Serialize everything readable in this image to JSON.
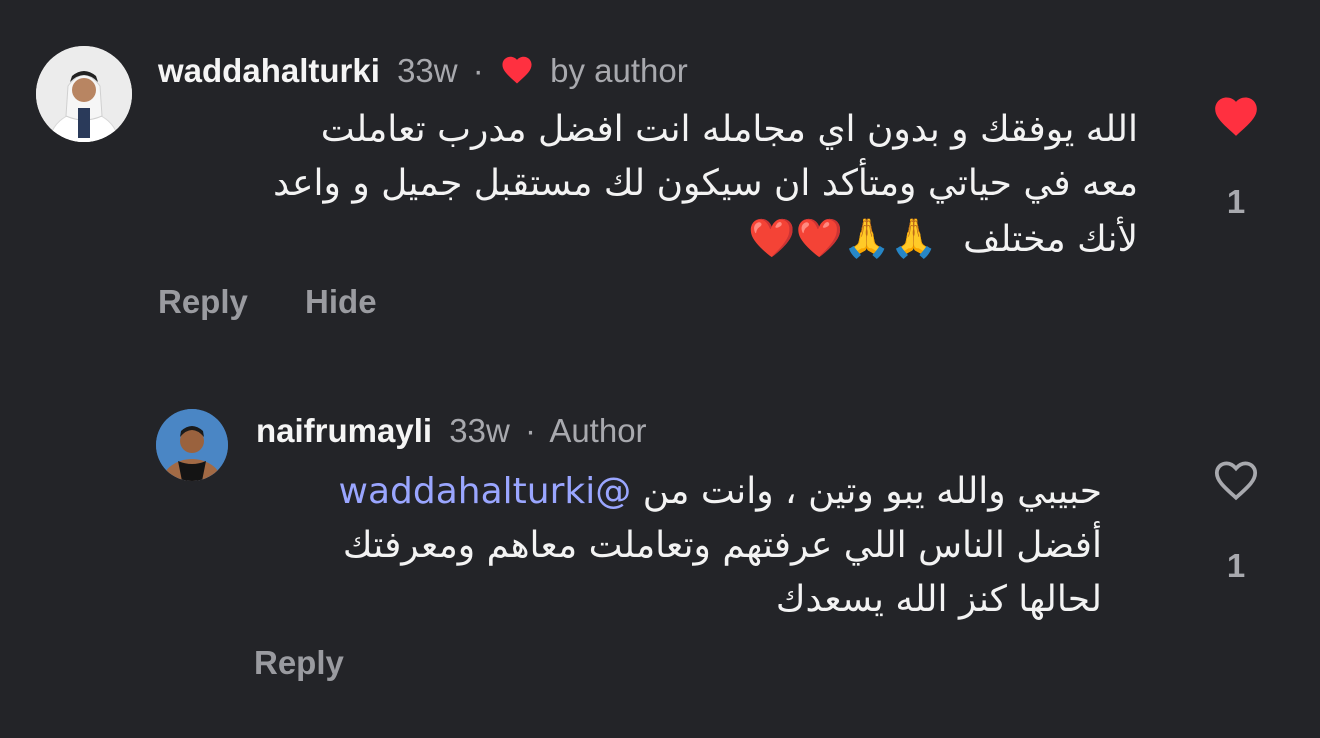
{
  "comments": [
    {
      "username": "waddahalturki",
      "time": "33w",
      "separator": "·",
      "liked_by_author_label": "by author",
      "text_lines": [
        "الله يوفقك و بدون اي مجامله انت افضل مدرب تعاملت",
        "معه في حياتي ومتأكد ان سيكون لك مستقبل جميل و واعد",
        "لأنك مختلف"
      ],
      "emojis": "❤️❤️🙏🙏",
      "reply_label": "Reply",
      "hide_label": "Hide",
      "like_count": "1",
      "liked": true,
      "colors": {
        "heart": "#ff3040"
      }
    },
    {
      "username": "naifrumayli",
      "time": "33w",
      "separator": "·",
      "author_badge": "Author",
      "mention": "@waddahalturki",
      "text_line1_rest": "حبيبي والله يبو وتين ، وانت من",
      "text_lines": [
        "أفضل الناس اللي عرفتهم وتعاملت معاهم ومعرفتك",
        "لحالها كنز الله يسعدك"
      ],
      "reply_label": "Reply",
      "like_count": "1",
      "liked": false
    }
  ],
  "icons": {
    "avatar1": "avatar-man-in-white-thobe",
    "avatar2": "avatar-man-in-black-tank-top",
    "liked_heart": "heart-filled-icon",
    "unliked_heart": "heart-outline-icon"
  }
}
